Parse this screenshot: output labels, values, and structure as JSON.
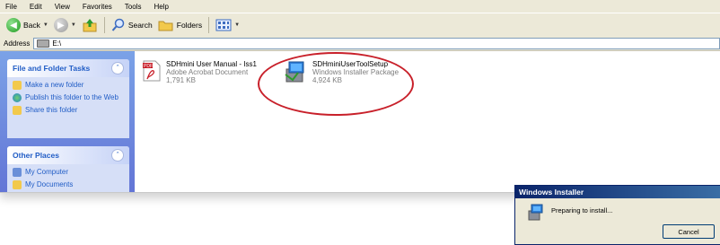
{
  "menu": [
    "File",
    "Edit",
    "View",
    "Favorites",
    "Tools",
    "Help"
  ],
  "toolbar": {
    "back_label": "Back",
    "search_label": "Search",
    "folders_label": "Folders"
  },
  "address": {
    "label": "Address",
    "value": "E:\\"
  },
  "task_pane": {
    "file_tasks": {
      "title": "File and Folder Tasks",
      "items": [
        "Make a new folder",
        "Publish this folder to the Web",
        "Share this folder"
      ]
    },
    "other_places": {
      "title": "Other Places",
      "items": [
        "My Computer",
        "My Documents"
      ]
    }
  },
  "files": [
    {
      "name": "SDHmini User Manual - Iss1",
      "type": "Adobe Acrobat Document",
      "size": "1,791 KB",
      "icon": "pdf-icon"
    },
    {
      "name": "SDHminiUserToolSetup",
      "type": "Windows Installer Package",
      "size": "4,924 KB",
      "icon": "msi-installer-icon"
    }
  ],
  "installer": {
    "title": "Windows Installer",
    "message": "Preparing to install...",
    "cancel_label": "Cancel"
  },
  "colors": {
    "highlight": "#c8202a",
    "taskpane": "#7ba2e7",
    "task_link": "#215dc6"
  }
}
